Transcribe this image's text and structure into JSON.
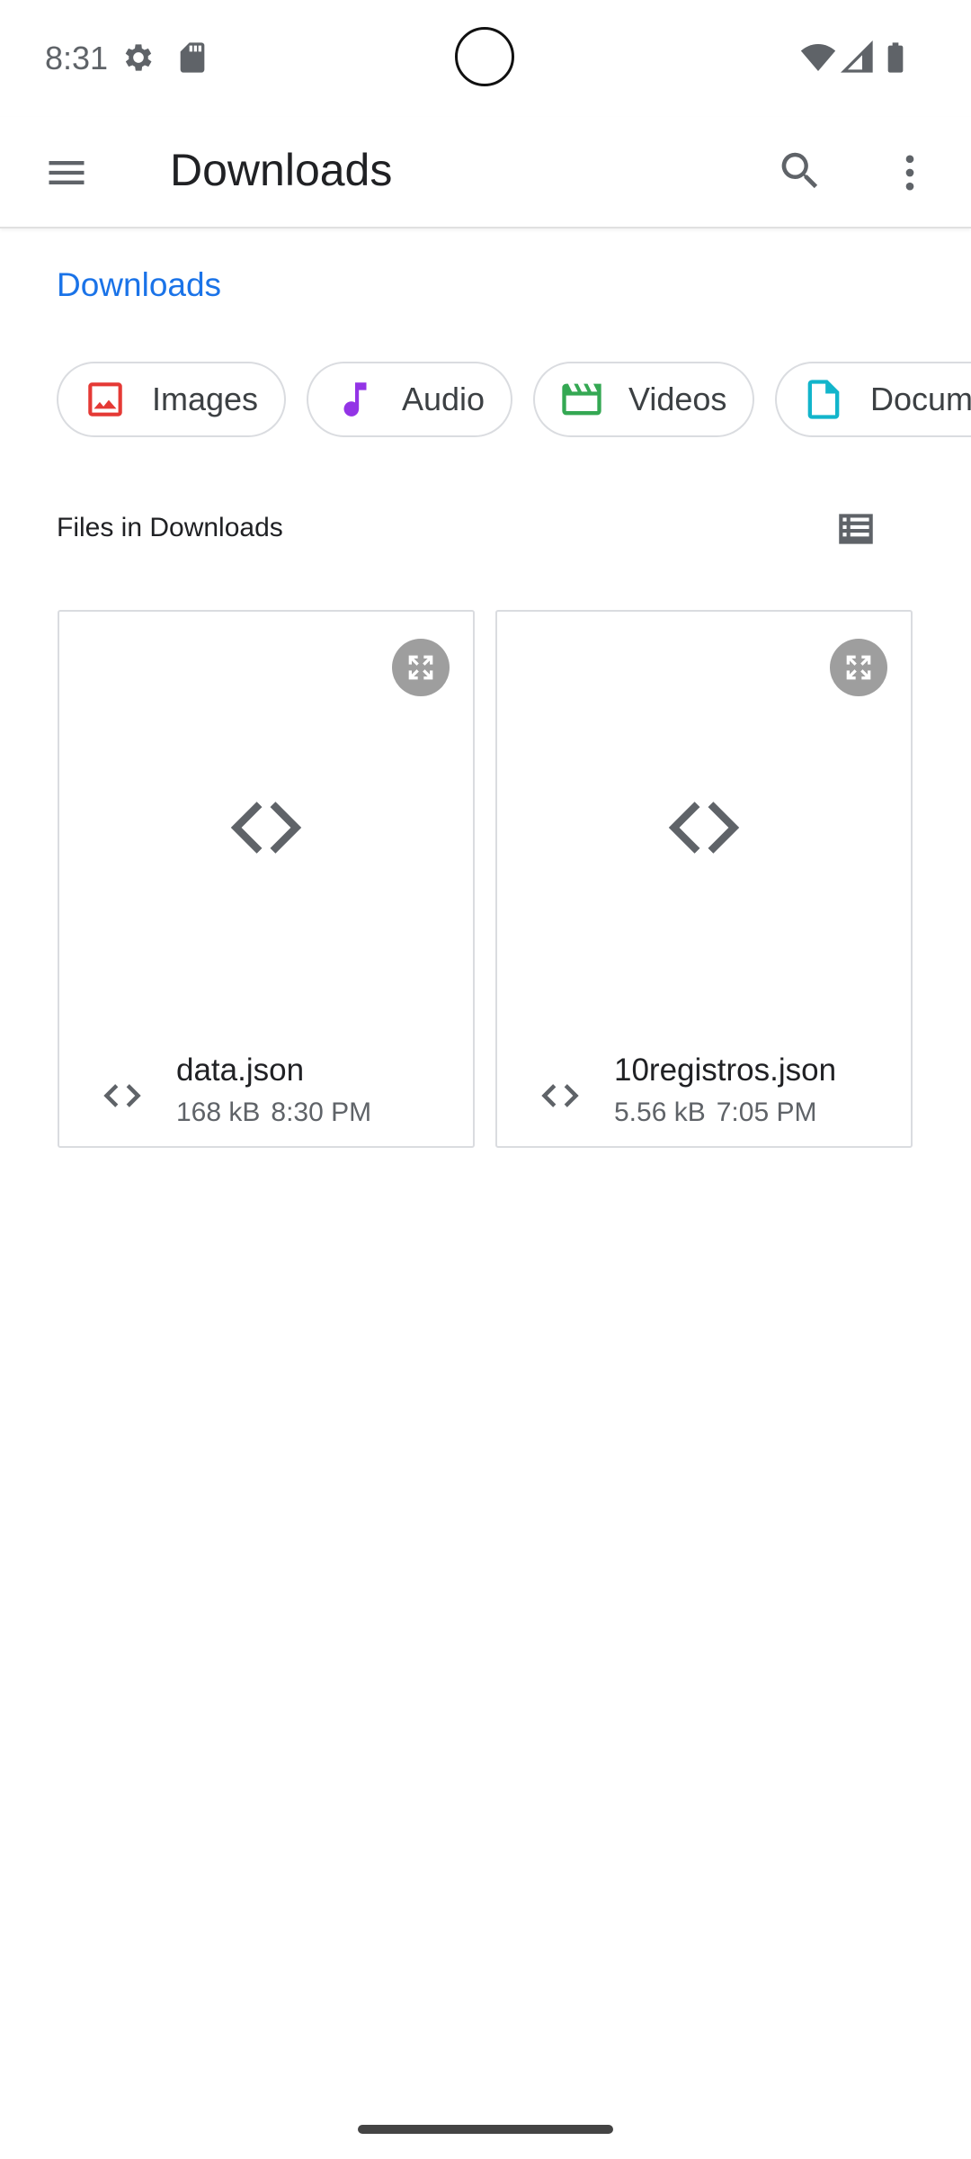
{
  "status_bar": {
    "time": "8:31",
    "icons": [
      "settings-gear-icon",
      "sd-card-icon",
      "wifi-icon",
      "cell-signal-icon",
      "battery-icon"
    ]
  },
  "app_bar": {
    "title": "Downloads",
    "menu_icon": "hamburger-menu-icon",
    "search_icon": "search-icon",
    "more_icon": "more-vert-icon"
  },
  "breadcrumb": {
    "root": "Downloads",
    "color": "#1a73e8"
  },
  "chips": [
    {
      "label": "Images",
      "icon": "image-icon",
      "color": "#e53935"
    },
    {
      "label": "Audio",
      "icon": "music-note-icon",
      "color": "#9334e6"
    },
    {
      "label": "Videos",
      "icon": "movie-icon",
      "color": "#34a853"
    },
    {
      "label": "Docum",
      "icon": "document-icon",
      "color": "#12b5cb"
    }
  ],
  "section": {
    "title": "Files in Downloads",
    "view_toggle_icon": "list-view-icon"
  },
  "files": [
    {
      "name": "data.json",
      "size": "168 kB",
      "time": "8:30 PM",
      "icon": "code-icon"
    },
    {
      "name": "10registros.json",
      "size": "5.56 kB",
      "time": "7:05 PM",
      "icon": "code-icon"
    }
  ]
}
